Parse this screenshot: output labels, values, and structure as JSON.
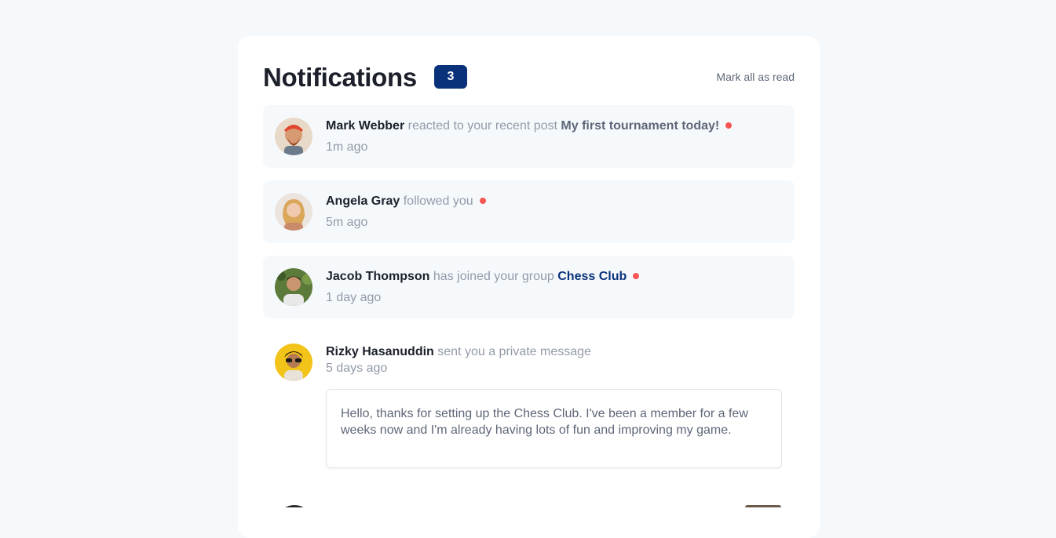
{
  "header": {
    "title": "Notifications",
    "unread_count": "3",
    "mark_all_label": "Mark all as read"
  },
  "notifications": [
    {
      "actor": "Mark Webber",
      "action": "reacted to your recent post",
      "target": "My first tournament today!",
      "time": "1m ago",
      "unread": true,
      "avatar": "avatar-mark-webber"
    },
    {
      "actor": "Angela Gray",
      "action": "followed you",
      "target": "",
      "time": "5m ago",
      "unread": true,
      "avatar": "avatar-angela-gray"
    },
    {
      "actor": "Jacob Thompson",
      "action": "has joined your group",
      "target": "Chess Club",
      "time": "1 day ago",
      "unread": true,
      "avatar": "avatar-jacob-thompson"
    },
    {
      "actor": "Rizky Hasanuddin",
      "action": "sent you a private message",
      "target": "",
      "time": "5 days ago",
      "unread": false,
      "avatar": "avatar-rizky-hasanuddin",
      "message": "Hello, thanks for setting up the Chess Club. I've been a member for a few weeks now and I'm already having lots of fun and improving my game."
    }
  ],
  "colors": {
    "page_bg": "#f6f9fc",
    "badge_bg": "#0a327b",
    "unread_dot": "#f65552",
    "actor_text": "#1c202b",
    "muted_text": "#939aa8"
  }
}
